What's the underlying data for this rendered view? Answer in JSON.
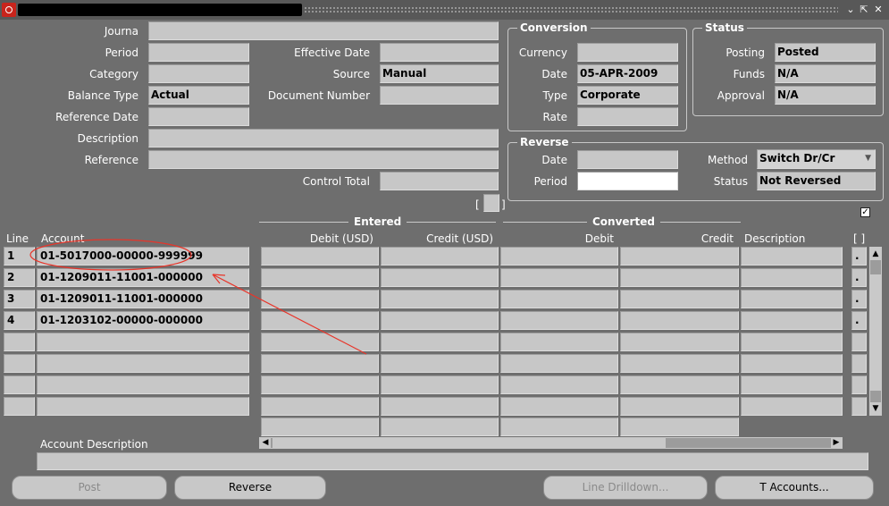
{
  "title_bar": {
    "minimize_glyph": "⌄",
    "restore_glyph": "⇱",
    "close_glyph": "✕"
  },
  "header": {
    "journal_label": "Journa",
    "period_label": "Period",
    "category_label": "Category",
    "balance_type_label": "Balance Type",
    "balance_type_value": "Actual",
    "reference_date_label": "Reference Date",
    "description_label": "Description",
    "reference_label": "Reference",
    "effective_date_label": "Effective Date",
    "source_label": "Source",
    "source_value": "Manual",
    "document_number_label": "Document Number",
    "control_total_label": "Control Total",
    "bracket_left": "[",
    "bracket_right": "]"
  },
  "conversion": {
    "title": "Conversion",
    "currency_label": "Currency",
    "date_label": "Date",
    "date_value": "05-APR-2009",
    "type_label": "Type",
    "type_value": "Corporate",
    "rate_label": "Rate"
  },
  "status": {
    "title": "Status",
    "posting_label": "Posting",
    "posting_value": "Posted",
    "funds_label": "Funds",
    "funds_value": "N/A",
    "approval_label": "Approval",
    "approval_value": "N/A"
  },
  "reverse": {
    "title": "Reverse",
    "date_label": "Date",
    "period_label": "Period",
    "method_label": "Method",
    "method_value": "Switch Dr/Cr",
    "status_label": "Status",
    "status_value": "Not Reversed"
  },
  "lines": {
    "group_entered": "Entered",
    "group_converted": "Converted",
    "columns": {
      "line": "Line",
      "account": "Account",
      "debit_usd": "Debit (USD)",
      "credit_usd": "Credit (USD)",
      "debit": "Debit",
      "credit": "Credit",
      "description": "Description",
      "flex": "[ ]"
    },
    "rows": [
      {
        "line": "1",
        "account": "01-5017000-00000-999999",
        "flex": "."
      },
      {
        "line": "2",
        "account": "01-1209011-11001-000000",
        "flex": "."
      },
      {
        "line": "3",
        "account": "01-1209011-11001-000000",
        "flex": "."
      },
      {
        "line": "4",
        "account": "01-1203102-00000-000000",
        "flex": "."
      },
      {
        "line": "",
        "account": "",
        "flex": ""
      },
      {
        "line": "",
        "account": "",
        "flex": ""
      },
      {
        "line": "",
        "account": "",
        "flex": ""
      },
      {
        "line": "",
        "account": "",
        "flex": ""
      }
    ],
    "checkbox_mark": "✓"
  },
  "account_description_label": "Account Description",
  "buttons": {
    "post": "Post",
    "reverse": "Reverse",
    "line_drilldown": "Line Drilldown...",
    "t_accounts": "T Accounts..."
  },
  "annotation": {
    "color": "#e8352a"
  }
}
